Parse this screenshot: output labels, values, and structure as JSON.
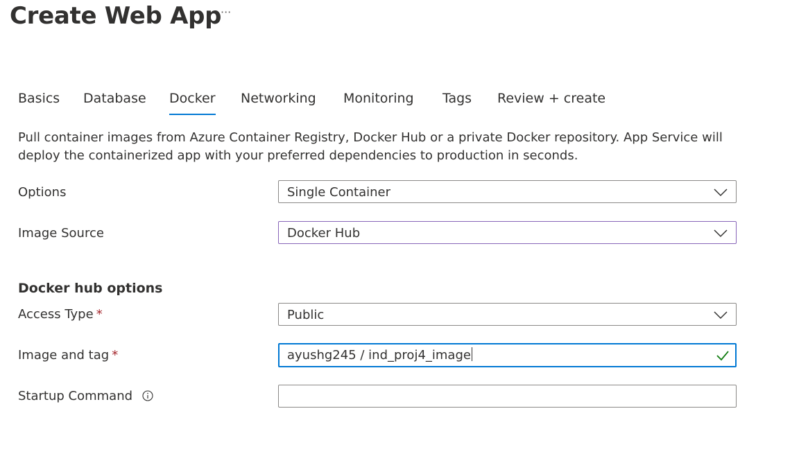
{
  "header": {
    "title": "Create Web App",
    "more_label": "···"
  },
  "tabs": [
    {
      "label": "Basics",
      "active": false
    },
    {
      "label": "Database",
      "active": false
    },
    {
      "label": "Docker",
      "active": true
    },
    {
      "label": "Networking",
      "active": false
    },
    {
      "label": "Monitoring",
      "active": false
    },
    {
      "label": "Tags",
      "active": false
    },
    {
      "label": "Review + create",
      "active": false
    }
  ],
  "intro": "Pull container images from Azure Container Registry, Docker Hub or a private Docker repository. App Service will deploy the containerized app with your preferred dependencies to production in seconds.",
  "form": {
    "options": {
      "label": "Options",
      "value": "Single Container"
    },
    "image_source": {
      "label": "Image Source",
      "value": "Docker Hub"
    },
    "section_title": "Docker hub options",
    "access_type": {
      "label": "Access Type",
      "required": "*",
      "value": "Public"
    },
    "image_tag": {
      "label": "Image and tag",
      "required": "*",
      "value": "ayushg245 / ind_proj4_image"
    },
    "startup_command": {
      "label": "Startup Command",
      "value": ""
    }
  },
  "colors": {
    "accent": "#0078d4",
    "required": "#a4262c",
    "valid_check": "#107c10",
    "hover_border": "#8764b8"
  },
  "icons": {
    "dropdown": "chevron-down-icon",
    "valid": "checkmark-icon",
    "info": "info-icon"
  }
}
